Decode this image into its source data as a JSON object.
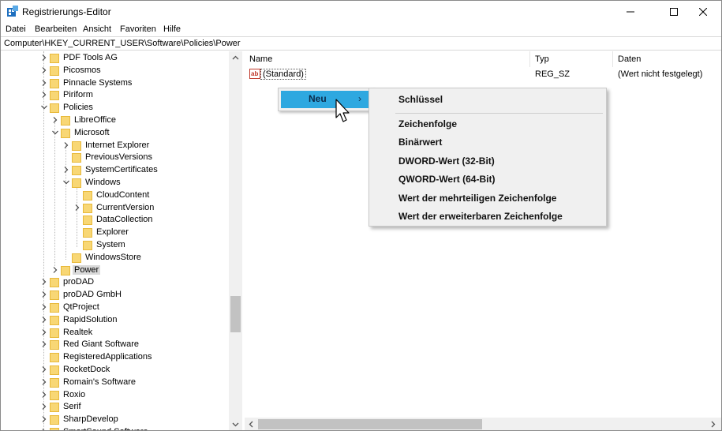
{
  "window": {
    "title": "Registrierungs-Editor"
  },
  "menu": [
    "Datei",
    "Bearbeiten",
    "Ansicht",
    "Favoriten",
    "Hilfe"
  ],
  "address": "Computer\\HKEY_CURRENT_USER\\Software\\Policies\\Power",
  "tree": [
    {
      "label": "PDF Tools AG",
      "level": 1,
      "chevron": "right"
    },
    {
      "label": "Picosmos",
      "level": 1,
      "chevron": "right"
    },
    {
      "label": "Pinnacle Systems",
      "level": 1,
      "chevron": "right"
    },
    {
      "label": "Piriform",
      "level": 1,
      "chevron": "right"
    },
    {
      "label": "Policies",
      "level": 1,
      "chevron": "down"
    },
    {
      "label": "LibreOffice",
      "level": 2,
      "chevron": "right"
    },
    {
      "label": "Microsoft",
      "level": 2,
      "chevron": "down"
    },
    {
      "label": "Internet Explorer",
      "level": 3,
      "chevron": "right"
    },
    {
      "label": "PreviousVersions",
      "level": 3,
      "chevron": "none"
    },
    {
      "label": "SystemCertificates",
      "level": 3,
      "chevron": "right"
    },
    {
      "label": "Windows",
      "level": 3,
      "chevron": "down"
    },
    {
      "label": "CloudContent",
      "level": 4,
      "chevron": "none"
    },
    {
      "label": "CurrentVersion",
      "level": 4,
      "chevron": "right"
    },
    {
      "label": "DataCollection",
      "level": 4,
      "chevron": "none"
    },
    {
      "label": "Explorer",
      "level": 4,
      "chevron": "none"
    },
    {
      "label": "System",
      "level": 4,
      "chevron": "none"
    },
    {
      "label": "WindowsStore",
      "level": 3,
      "chevron": "none"
    },
    {
      "label": "Power",
      "level": 2,
      "chevron": "right",
      "selected": true
    },
    {
      "label": "proDAD",
      "level": 1,
      "chevron": "right"
    },
    {
      "label": "proDAD GmbH",
      "level": 1,
      "chevron": "right"
    },
    {
      "label": "QtProject",
      "level": 1,
      "chevron": "right"
    },
    {
      "label": "RapidSolution",
      "level": 1,
      "chevron": "right"
    },
    {
      "label": "Realtek",
      "level": 1,
      "chevron": "right"
    },
    {
      "label": "Red Giant Software",
      "level": 1,
      "chevron": "right"
    },
    {
      "label": "RegisteredApplications",
      "level": 1,
      "chevron": "none"
    },
    {
      "label": "RocketDock",
      "level": 1,
      "chevron": "right"
    },
    {
      "label": "Romain's Software",
      "level": 1,
      "chevron": "right"
    },
    {
      "label": "Roxio",
      "level": 1,
      "chevron": "right"
    },
    {
      "label": "Serif",
      "level": 1,
      "chevron": "right"
    },
    {
      "label": "SharpDevelop",
      "level": 1,
      "chevron": "right"
    },
    {
      "label": "SmartSound Software",
      "level": 1,
      "chevron": "right"
    }
  ],
  "list": {
    "columns": [
      "Name",
      "Typ",
      "Daten"
    ],
    "rows": [
      {
        "name": "(Standard)",
        "type": "REG_SZ",
        "data": "(Wert nicht festgelegt)"
      }
    ]
  },
  "context_menu": {
    "label": "Neu",
    "arrow": "›"
  },
  "submenu": [
    "Schlüssel",
    "Zeichenfolge",
    "Binärwert",
    "DWORD-Wert (32-Bit)",
    "QWORD-Wert (64-Bit)",
    "Wert der mehrteiligen Zeichenfolge",
    "Wert der erweiterbaren Zeichenfolge"
  ],
  "colors": {
    "highlight": "#2ea8e0",
    "folder": "#f8d775",
    "menu_bg": "#f0f0f0"
  }
}
